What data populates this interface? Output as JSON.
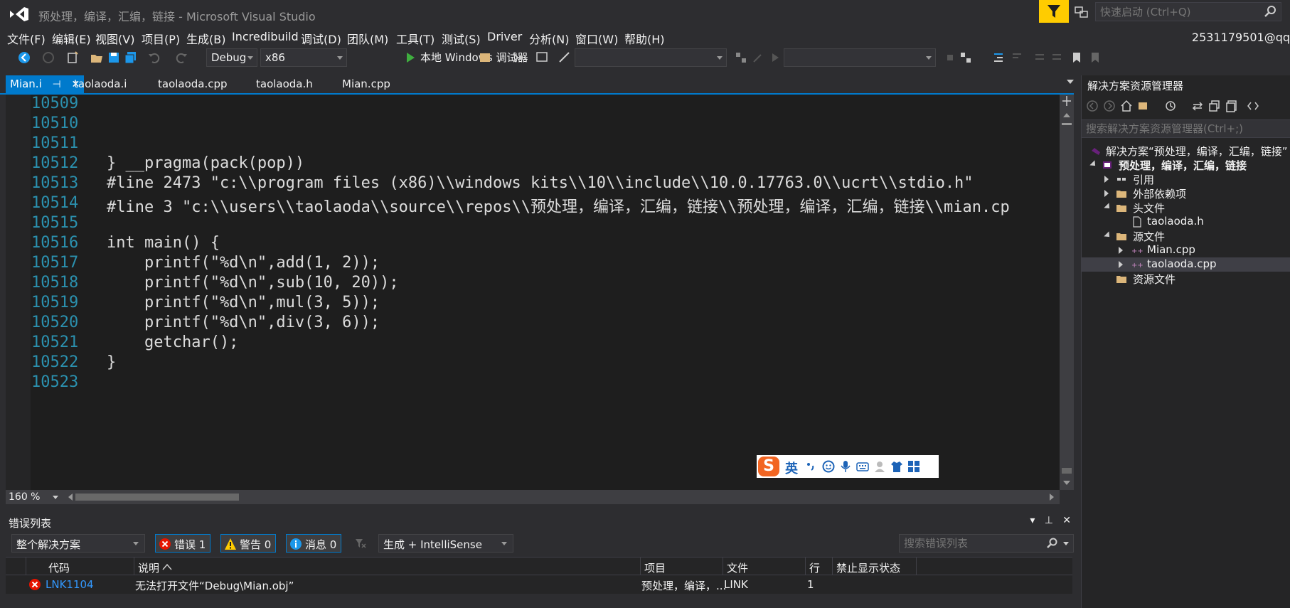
{
  "window": {
    "title": "预处理，编译，汇编，链接 - Microsoft Visual Studio",
    "quick_launch_placeholder": "快速启动 (Ctrl+Q)",
    "user": "2531179501@qq"
  },
  "menu": [
    "文件(F)",
    "编辑(E)",
    "视图(V)",
    "项目(P)",
    "生成(B)",
    "Incredibuild",
    "调试(D)",
    "团队(M)",
    "工具(T)",
    "测试(S)",
    "Driver",
    "分析(N)",
    "窗口(W)",
    "帮助(H)"
  ],
  "toolbar": {
    "config": "Debug",
    "platform": "x86",
    "run_label": "本地 Windows 调试器"
  },
  "tabs": [
    {
      "label": "Mian.i",
      "active": true
    },
    {
      "label": "taolaoda.i",
      "active": false
    },
    {
      "label": "taolaoda.cpp",
      "active": false
    },
    {
      "label": "taolaoda.h",
      "active": false
    },
    {
      "label": "Mian.cpp",
      "active": false
    }
  ],
  "editor": {
    "lines": [
      {
        "num": "10509",
        "code": ""
      },
      {
        "num": "10510",
        "code": ""
      },
      {
        "num": "10511",
        "code": ""
      },
      {
        "num": "10512",
        "code": "} __pragma(pack(pop))"
      },
      {
        "num": "10513",
        "code": "#line 2473 \"c:\\\\program files (x86)\\\\windows kits\\\\10\\\\include\\\\10.0.17763.0\\\\ucrt\\\\stdio.h\""
      },
      {
        "num": "10514",
        "code": "#line 3 \"c:\\\\users\\\\taolaoda\\\\source\\\\repos\\\\预处理，编译，汇编，链接\\\\预处理，编译，汇编，链接\\\\mian.cp"
      },
      {
        "num": "10515",
        "code": ""
      },
      {
        "num": "10516",
        "code": "int main() {"
      },
      {
        "num": "10517",
        "code": "    printf(\"%d\\n\",add(1, 2));"
      },
      {
        "num": "10518",
        "code": "    printf(\"%d\\n\",sub(10, 20));"
      },
      {
        "num": "10519",
        "code": "    printf(\"%d\\n\",mul(3, 5));"
      },
      {
        "num": "10520",
        "code": "    printf(\"%d\\n\",div(3, 6));"
      },
      {
        "num": "10521",
        "code": "    getchar();"
      },
      {
        "num": "10522",
        "code": "}"
      },
      {
        "num": "10523",
        "code": ""
      }
    ],
    "zoom": "160 %"
  },
  "ime": {
    "logo": "S",
    "mode": "英"
  },
  "error_list": {
    "title": "错误列表",
    "scope": "整个解决方案",
    "errors_label": "错误 1",
    "warnings_label": "警告 0",
    "messages_label": "消息 0",
    "build_filter": "生成 + IntelliSense",
    "search_placeholder": "搜索错误列表",
    "columns": [
      "代码",
      "说明",
      "项目",
      "文件",
      "行",
      "禁止显示状态"
    ],
    "rows": [
      {
        "code": "LNK1104",
        "desc": "无法打开文件“Debug\\Mian.obj”",
        "project": "预处理，编译，...",
        "file": "LINK",
        "line": "1",
        "suppress": ""
      }
    ]
  },
  "solution_explorer": {
    "title": "解决方案资源管理器",
    "search_placeholder": "搜索解决方案资源管理器(Ctrl+;)",
    "items": [
      {
        "label": "解决方案“预处理，编译，汇编，链接”",
        "level": 0,
        "expander": "none",
        "icon": "solution-icon"
      },
      {
        "label": "预处理，编译，汇编，链接",
        "level": 0,
        "expander": "open",
        "icon": "project-icon",
        "bold": true
      },
      {
        "label": "引用",
        "level": 1,
        "expander": "closed",
        "icon": "references-icon"
      },
      {
        "label": "外部依赖项",
        "level": 1,
        "expander": "closed",
        "icon": "folder-icon"
      },
      {
        "label": "头文件",
        "level": 1,
        "expander": "open",
        "icon": "folder-icon"
      },
      {
        "label": "taolaoda.h",
        "level": 2,
        "expander": "none",
        "icon": "header-file-icon"
      },
      {
        "label": "源文件",
        "level": 1,
        "expander": "open",
        "icon": "folder-icon"
      },
      {
        "label": "Mian.cpp",
        "level": 2,
        "expander": "closed",
        "icon": "cpp-file-icon"
      },
      {
        "label": "taolaoda.cpp",
        "level": 2,
        "expander": "closed",
        "icon": "cpp-file-icon",
        "selected": true
      },
      {
        "label": "资源文件",
        "level": 1,
        "expander": "none",
        "icon": "folder-icon"
      }
    ]
  },
  "colors": {
    "accent": "#007acc",
    "line_number": "#2b91af",
    "error_code": "#3399ff",
    "filter_highlight": "#ffcc00"
  }
}
